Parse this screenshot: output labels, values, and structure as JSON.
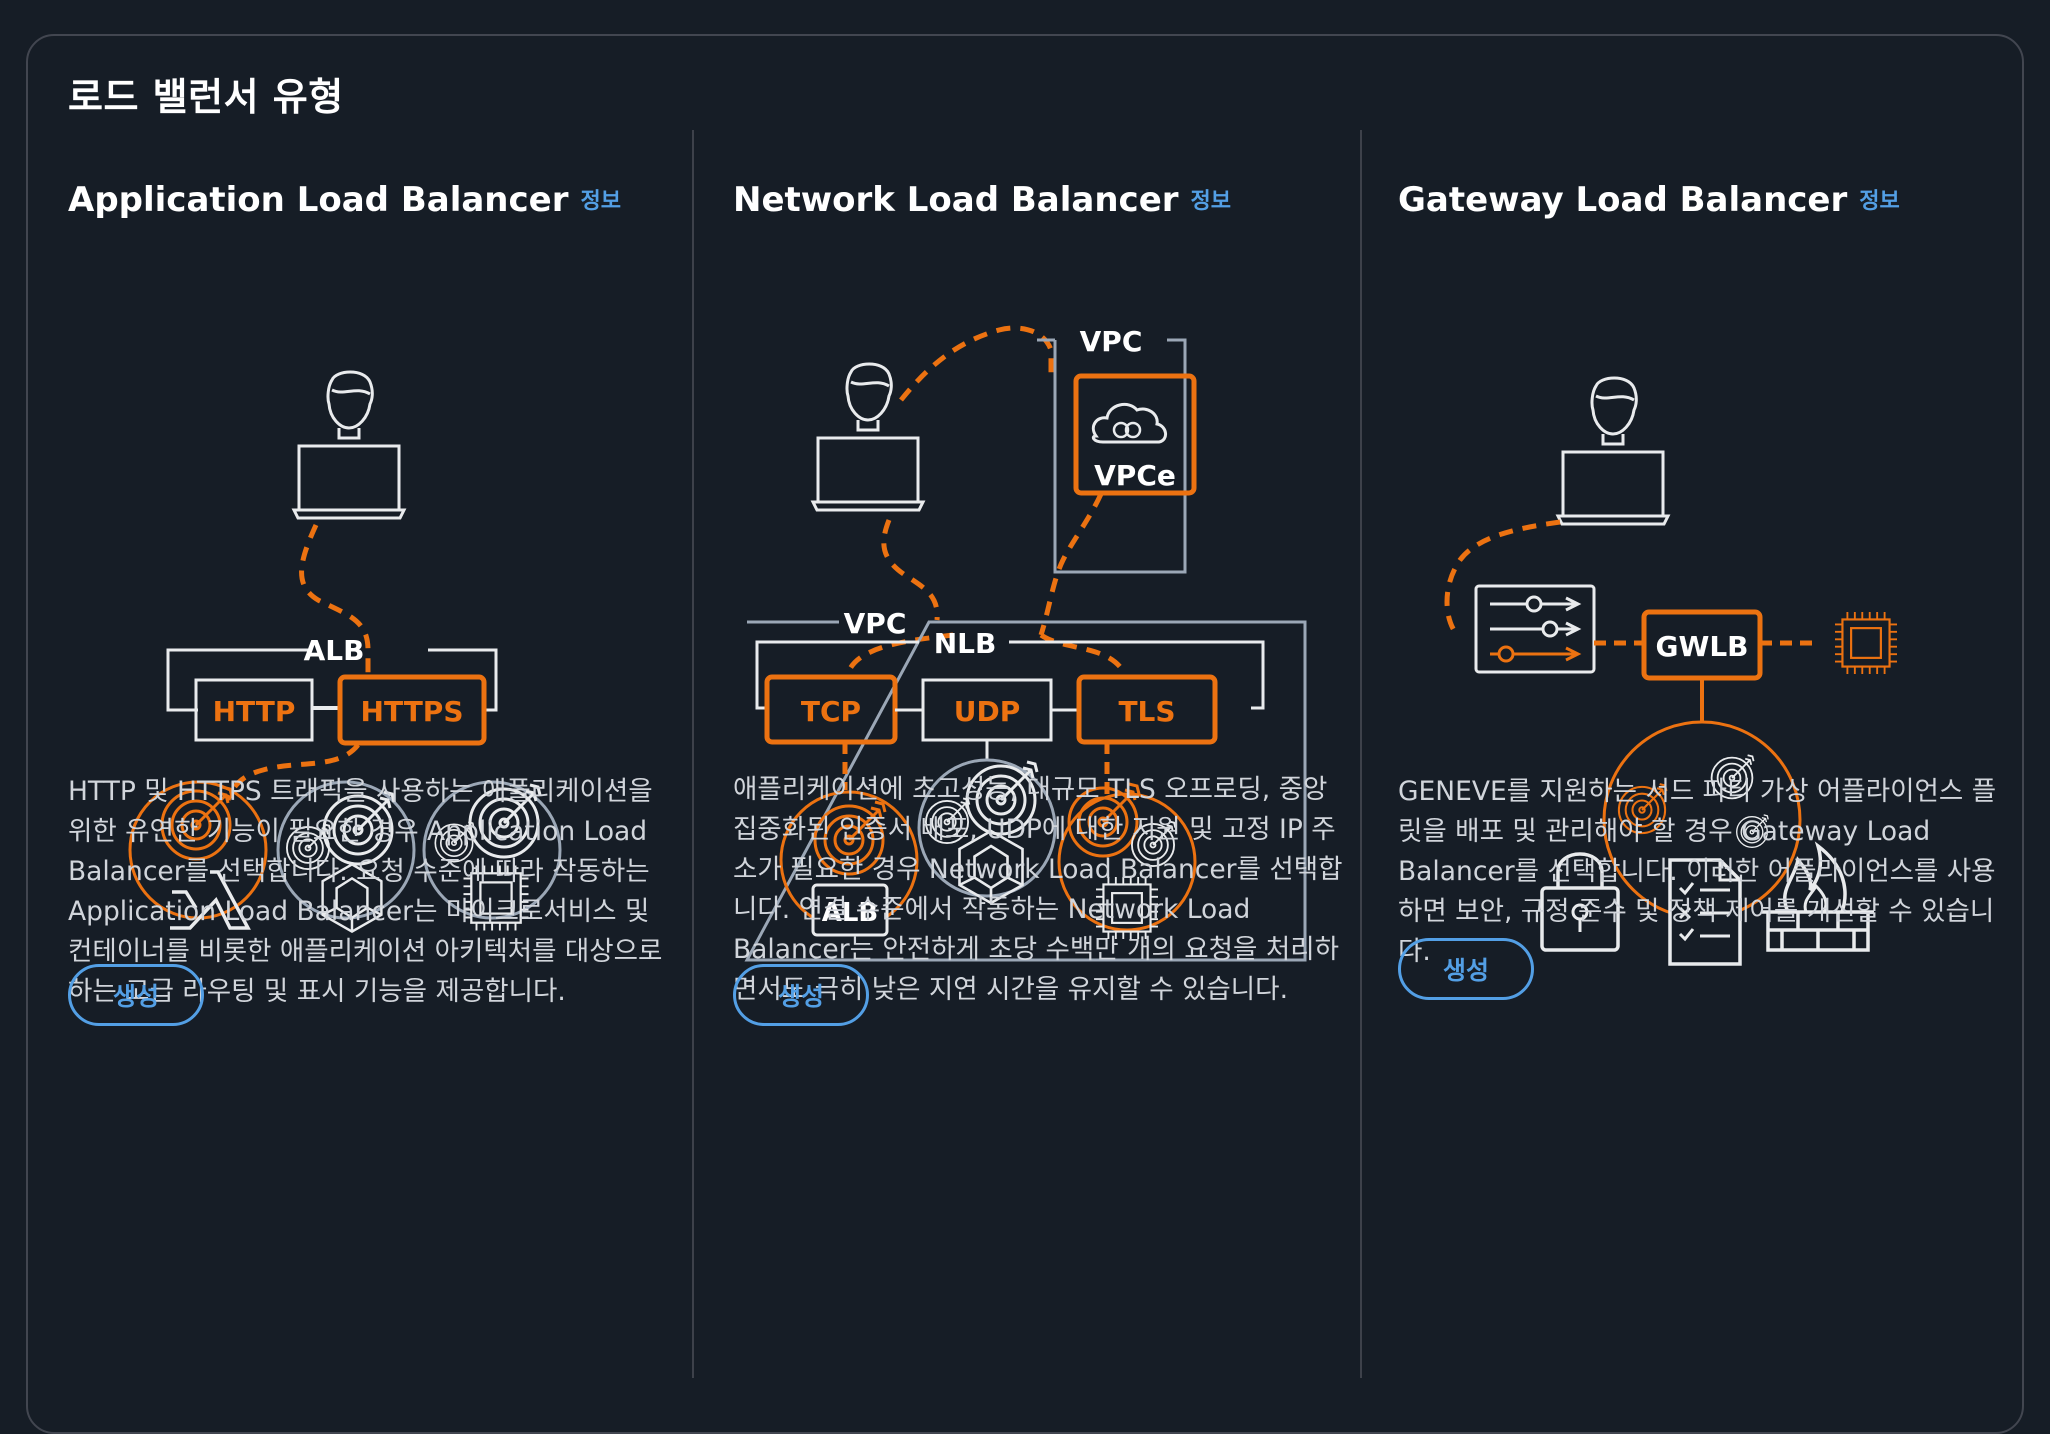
{
  "panel": {
    "title": "로드 밸런서 유형"
  },
  "colors": {
    "accent": "#ec7211",
    "link": "#539fe5",
    "line": "#e9ebed",
    "muted": "#9ba7b6"
  },
  "cards": [
    {
      "title": "Application Load Balancer",
      "info": "정보",
      "diagram": {
        "group_label": "ALB",
        "listeners": [
          "HTTP",
          "HTTPS"
        ]
      },
      "description": "HTTP 및 HTTPS 트래픽을 사용하는 애플리케이션을 위한 유연한 기능이 필요한 경우 Application Load Balancer를 선택합니다. 요청 수준에 따라 작동하는 Application Load Balancer는 마이크로서비스 및 컨테이너를 비롯한 애플리케이션 아키텍처를 대상으로 하는 고급 라우팅 및 표시 기능을 제공합니다.",
      "button": "생성"
    },
    {
      "title": "Network Load Balancer",
      "info": "정보",
      "diagram": {
        "vpc_label": "VPC",
        "vpce_label": "VPCe",
        "outer_vpc_label": "VPC",
        "group_label": "NLB",
        "listeners": [
          "TCP",
          "UDP",
          "TLS"
        ],
        "target_label": "ALB"
      },
      "description": "애플리케이션에 초고성능, 대규모 TLS 오프로딩, 중앙 집중화된 인증서 배포, UDP에 대한 지원 및 고정 IP 주소가 필요한 경우 Network Load Balancer를 선택합니다. 연결 수준에서 작동하는 Network Load Balancer는 안전하게 초당 수백만 개의 요청을 처리하면서도 극히 낮은 지연 시간을 유지할 수 있습니다.",
      "button": "생성"
    },
    {
      "title": "Gateway Load Balancer",
      "info": "정보",
      "diagram": {
        "center_label": "GWLB"
      },
      "description": "GENEVE를 지원하는 서드 파티 가상 어플라이언스 플릿을 배포 및 관리해야 할 경우 Gateway Load Balancer를 선택합니다. 이러한 어플라이언스를 사용하면 보안, 규정 준수 및 정책 제어를 개선할 수 있습니다.",
      "button": "생성"
    }
  ]
}
